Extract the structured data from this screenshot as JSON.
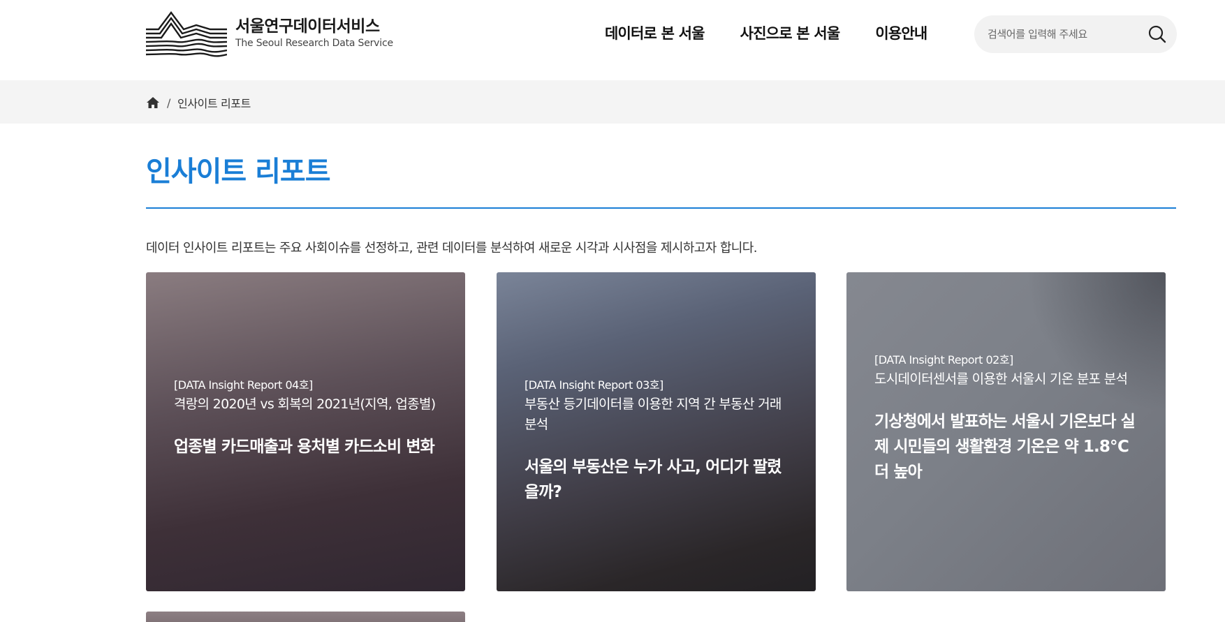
{
  "brand": {
    "title": "서울연구데이터서비스",
    "subtitle": "The Seoul Research Data Service"
  },
  "nav": {
    "items": [
      {
        "label": "데이터로 본 서울"
      },
      {
        "label": "사진으로 본 서울"
      },
      {
        "label": "이용안내"
      }
    ]
  },
  "search": {
    "placeholder": "검색어를 입력해 주세요",
    "icon": "search-icon"
  },
  "breadcrumb": {
    "home_icon": "home-icon",
    "separator": "/",
    "current": "인사이트 리포트"
  },
  "page": {
    "title": "인사이트 리포트",
    "intro": "데이터 인사이트 리포트는 주요 사회이슈를 선정하고, 관련 데이터를 분석하여 새로운 시각과 시사점을 제시하고자 합니다."
  },
  "cards": [
    {
      "tag": "[DATA Insight Report 04호]",
      "desc": "격랑의 2020년 vs 회복의 2021년(지역, 업종별)",
      "headline": "업종별 카드매출과 용처별 카드소비 변화"
    },
    {
      "tag": "[DATA Insight Report 03호]",
      "desc": "부동산 등기데이터를 이용한 지역 간 부동산 거래분석",
      "headline": "서울의 부동산은 누가 사고, 어디가 팔렸을까?"
    },
    {
      "tag": "[DATA Insight Report 02호]",
      "desc": "도시데이터센서를 이용한 서울시 기온 분포 분석",
      "headline": "기상청에서 발표하는 서울시 기온보다 실제 시민들의 생활환경 기온은 약 1.8℃ 더 높아"
    }
  ],
  "colors": {
    "accent": "#1a7ed6",
    "breadcrumb_bg": "#f4f4f4",
    "search_bg": "#f2f2f2"
  }
}
